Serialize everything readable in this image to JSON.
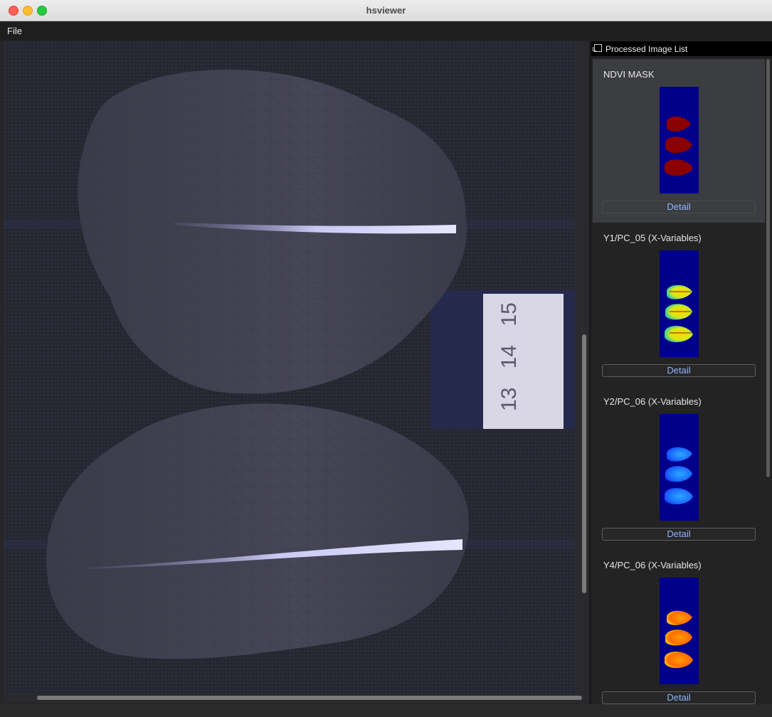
{
  "window": {
    "title": "hsviewer"
  },
  "menu": {
    "file": "File"
  },
  "viewer": {
    "label_text": [
      "13",
      "14",
      "15"
    ]
  },
  "panel": {
    "title": "Processed Image List",
    "items": [
      {
        "label": "NDVI MASK",
        "detail": "Detail",
        "colormap": "mask-red"
      },
      {
        "label": "Y1/PC_05 (X-Variables)",
        "detail": "Detail",
        "colormap": "jet-yellow-green"
      },
      {
        "label": "Y2/PC_06 (X-Variables)",
        "detail": "Detail",
        "colormap": "jet-blue"
      },
      {
        "label": "Y4/PC_06 (X-Variables)",
        "detail": "Detail",
        "colormap": "jet-orange"
      }
    ]
  },
  "colors": {
    "thumbnail_background": "#00008b",
    "detail_text": "#8fb4ff",
    "selected_item": "#3c3d40"
  }
}
